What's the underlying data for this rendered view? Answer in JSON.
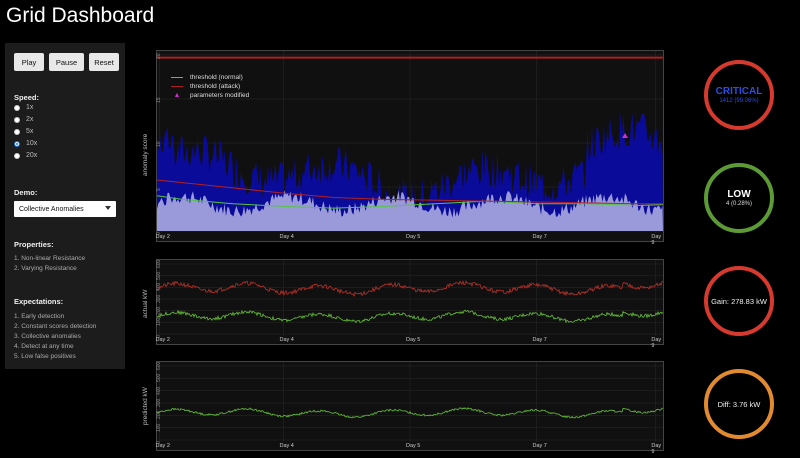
{
  "app": {
    "title": "Grid Dashboard"
  },
  "controls": {
    "play_label": "Play",
    "pause_label": "Pause",
    "reset_label": "Reset"
  },
  "speed": {
    "title": "Speed:",
    "options": [
      "1x",
      "2x",
      "5x",
      "10x",
      "20x"
    ],
    "selected": "10x"
  },
  "demo": {
    "title": "Demo:",
    "selected": "Collective Anomalies"
  },
  "properties": {
    "title": "Properties:",
    "items": [
      "1. Non-linear Resistance",
      "2. Varying Resistance"
    ]
  },
  "expectations": {
    "title": "Expectations:",
    "items": [
      "1. Early detection",
      "2. Constant scores detection",
      "3. Collective anomalies",
      "4. Detect at any time",
      "5. Low false positives"
    ]
  },
  "colors": {
    "critical": "#d63a2f",
    "low": "#5c9a35",
    "gain": "#d63a2f",
    "diff": "#e28a2f",
    "critical_text": "#2f4de0",
    "anomaly_fill": "#0b0ba8",
    "anomaly_area": "#b4b4e6",
    "threshold_normal": "#58c248",
    "threshold_attack": "#b22020",
    "marker": "#c832c8",
    "actual_red": "#b8322a",
    "actual_green": "#66c03a"
  },
  "status": {
    "critical": {
      "label": "CRITICAL",
      "detail": "1412 (99.06%)"
    },
    "low": {
      "label": "LOW",
      "detail": "4 (0.28%)"
    },
    "gain": {
      "label": "Gain: 278.83 kW"
    },
    "diff": {
      "label": "Diff: 3.76 kW"
    }
  },
  "chart_data": [
    {
      "type": "area",
      "ylabel": "anomaly score",
      "ylim": [
        0,
        20
      ],
      "yticks": [
        "0",
        "5",
        "10",
        "15",
        "20"
      ],
      "x_ticks": [
        "Day 2",
        "Day 4",
        "Day 5",
        "Day 7",
        "Day 9"
      ],
      "legend": {
        "placement": "top-left",
        "items": [
          "threshold (normal)",
          "threshold (attack)",
          "parameters modified"
        ]
      },
      "series": [
        {
          "name": "threshold (normal)",
          "x": [
            0,
            0.05,
            0.15,
            0.25,
            0.35,
            0.45,
            0.55,
            0.65,
            0.75,
            0.85,
            0.95,
            1
          ],
          "values": [
            4.0,
            3.6,
            3.1,
            2.8,
            2.6,
            2.8,
            3.1,
            3.4,
            3.1,
            3.1,
            2.9,
            3.0
          ]
        },
        {
          "name": "threshold (attack)",
          "x": [
            0,
            0.05,
            0.15,
            0.25,
            0.35,
            0.45,
            0.55,
            0.65,
            0.75,
            0.85,
            0.95,
            1
          ],
          "values": [
            5.8,
            5.5,
            4.9,
            4.3,
            3.8,
            3.6,
            3.5,
            3.4,
            3.3,
            3.2,
            3.1,
            3.1
          ]
        }
      ],
      "markers": [
        {
          "name": "parameters modified",
          "x": 0.925,
          "y": 10.8
        }
      ]
    },
    {
      "type": "line",
      "ylabel": "actual kW",
      "ylim": [
        0,
        600
      ],
      "yticks": [
        "0",
        "100",
        "200",
        "300",
        "400",
        "500",
        "600"
      ],
      "x_ticks": [
        "Day 2",
        "Day 4",
        "Day 5",
        "Day 7",
        "Day 9"
      ],
      "series": [
        {
          "name": "",
          "base": 390,
          "amplitude": 35,
          "noise": 18
        },
        {
          "name": "",
          "base": 150,
          "amplitude": 30,
          "noise": 15
        }
      ]
    },
    {
      "type": "line",
      "ylabel": "predicted kW",
      "ylim": [
        0,
        600
      ],
      "yticks": [
        "0",
        "100",
        "200",
        "300",
        "400",
        "500",
        "600"
      ],
      "x_ticks": [
        "Day 2",
        "Day 4",
        "Day 5",
        "Day 7",
        "Day 9"
      ],
      "series": [
        {
          "name": "",
          "base": 220,
          "amplitude": 25,
          "noise": 8
        }
      ]
    }
  ]
}
